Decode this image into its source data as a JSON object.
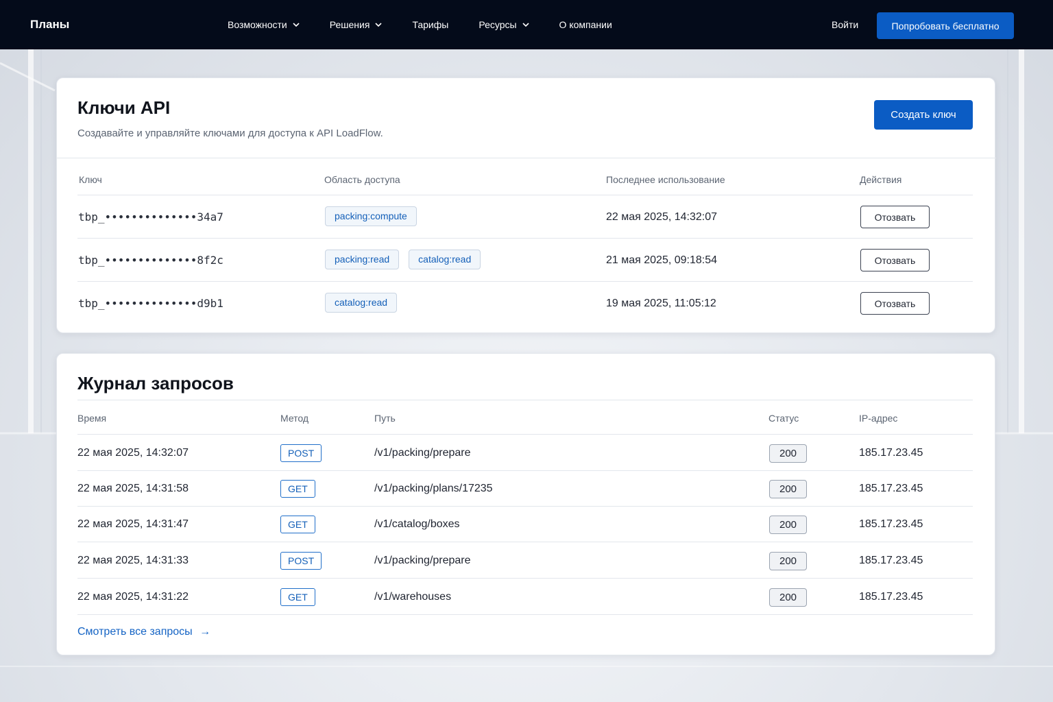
{
  "nav": {
    "brand": "Планы",
    "items": [
      {
        "label": "Возможности",
        "has_dropdown": true
      },
      {
        "label": "Решения",
        "has_dropdown": true
      },
      {
        "label": "Тарифы",
        "has_dropdown": false
      },
      {
        "label": "Ресурсы",
        "has_dropdown": true
      },
      {
        "label": "О компании",
        "has_dropdown": false
      }
    ],
    "login": "Войти",
    "cta": "Попробовать бесплатно"
  },
  "keys": {
    "title": "Ключи API",
    "subtitle": "Создавайте и управляйте ключами для доступа к API LoadFlow.",
    "create_label": "Создать ключ",
    "headers": [
      "Ключ",
      "Область доступа",
      "Последнее использование",
      "Действия"
    ],
    "rows": [
      {
        "key": "tbp_••••••••••••••34a7",
        "scopes": [
          "packing:compute"
        ],
        "last_used": "22 мая 2025, 14:32:07",
        "action": "Отозвать"
      },
      {
        "key": "tbp_••••••••••••••8f2c",
        "scopes": [
          "packing:read",
          "catalog:read"
        ],
        "last_used": "21 мая 2025, 09:18:54",
        "action": "Отозвать"
      },
      {
        "key": "tbp_••••••••••••••d9b1",
        "scopes": [
          "catalog:read"
        ],
        "last_used": "19 мая 2025, 11:05:12",
        "action": "Отозвать"
      }
    ]
  },
  "log": {
    "title": "Журнал запросов",
    "headers": [
      "Время",
      "Метод",
      "Путь",
      "Статус",
      "IP-адрес"
    ],
    "rows": [
      {
        "time": "22 мая 2025, 14:32:07",
        "method": "POST",
        "path": "/v1/packing/prepare",
        "status": "200",
        "ip": "185.17.23.45"
      },
      {
        "time": "22 мая 2025, 14:31:58",
        "method": "GET",
        "path": "/v1/packing/plans/17235",
        "status": "200",
        "ip": "185.17.23.45"
      },
      {
        "time": "22 мая 2025, 14:31:47",
        "method": "GET",
        "path": "/v1/catalog/boxes",
        "status": "200",
        "ip": "185.17.23.45"
      },
      {
        "time": "22 мая 2025, 14:31:33",
        "method": "POST",
        "path": "/v1/packing/prepare",
        "status": "200",
        "ip": "185.17.23.45"
      },
      {
        "time": "22 мая 2025, 14:31:22",
        "method": "GET",
        "path": "/v1/warehouses",
        "status": "200",
        "ip": "185.17.23.45"
      }
    ],
    "view_all": "Смотреть все запросы",
    "view_all_arrow": "→"
  }
}
